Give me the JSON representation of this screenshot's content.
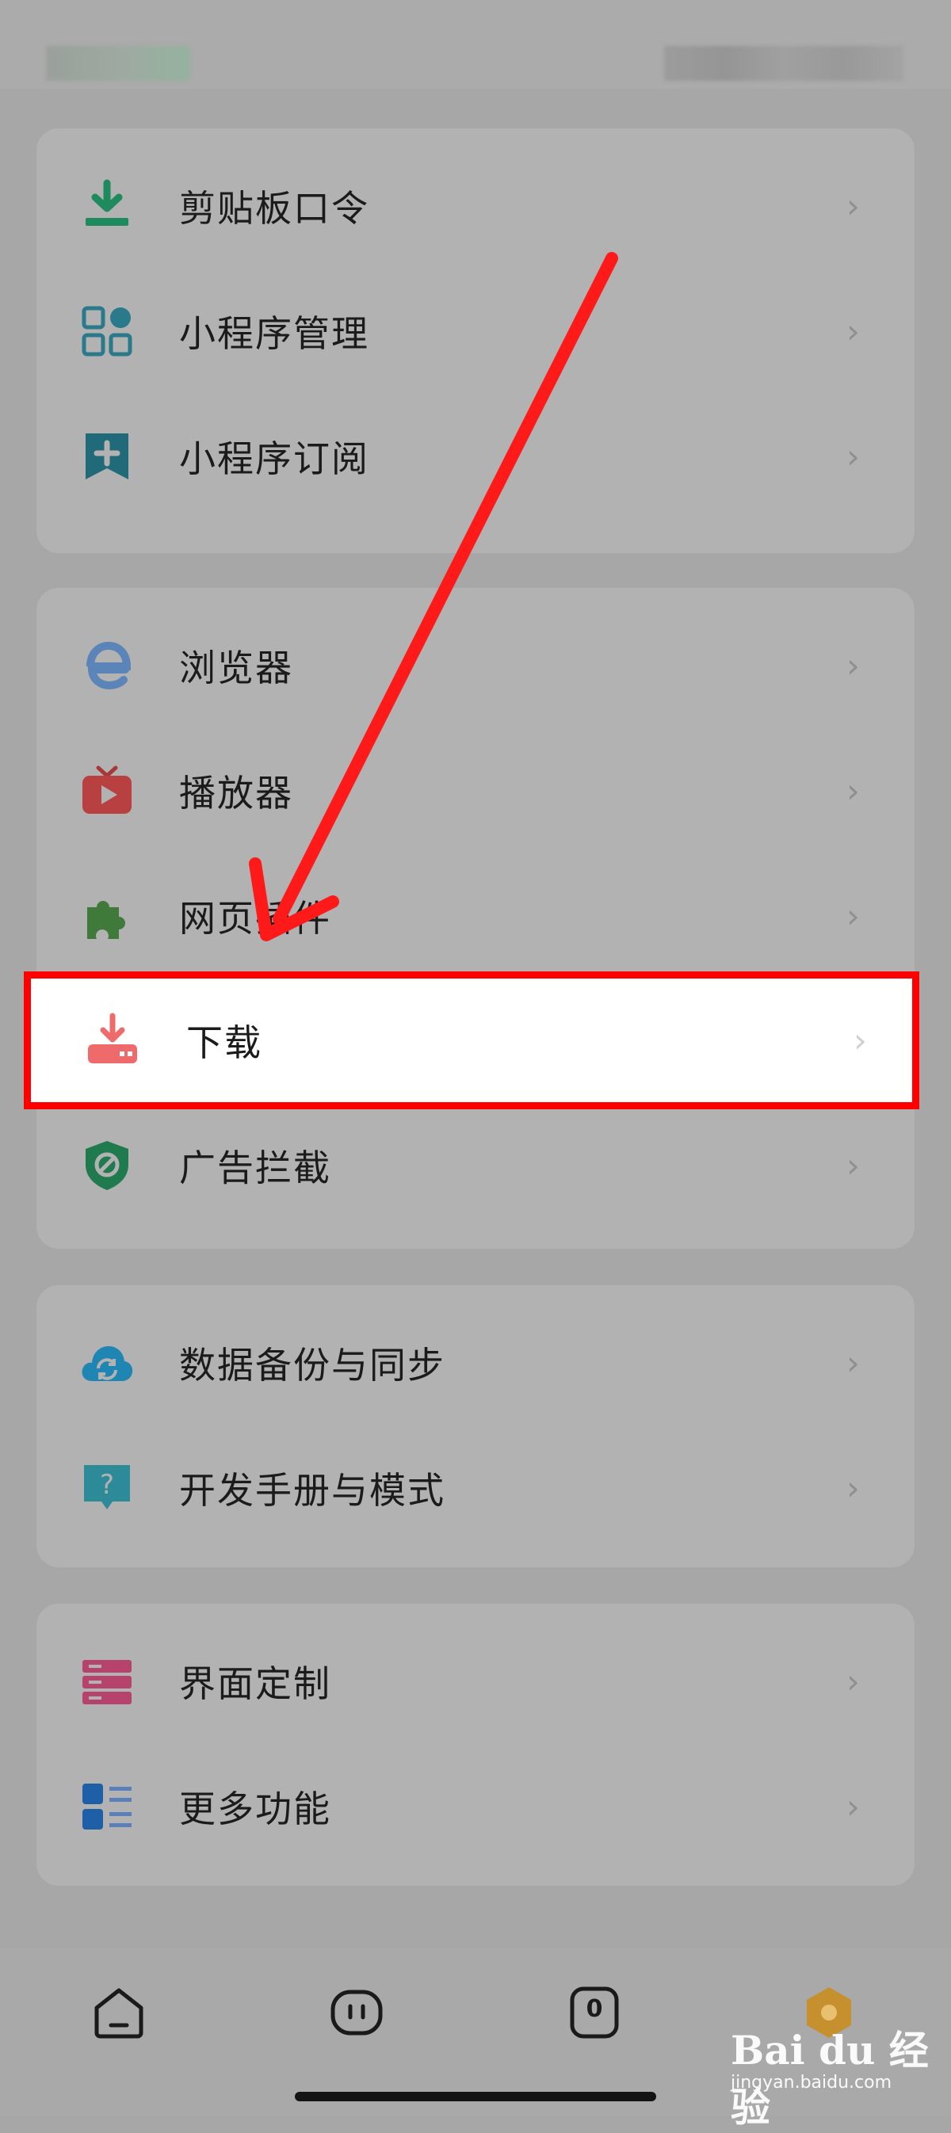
{
  "status_bar": {
    "blurred": true
  },
  "groups": [
    {
      "items": [
        {
          "label": "剪贴板口令",
          "icon": "download-tray-icon"
        },
        {
          "label": "小程序管理",
          "icon": "apps-grid-icon"
        },
        {
          "label": "小程序订阅",
          "icon": "bookmark-plus-icon"
        }
      ]
    },
    {
      "items": [
        {
          "label": "浏览器",
          "icon": "browser-e-icon"
        },
        {
          "label": "播放器",
          "icon": "tv-play-icon"
        },
        {
          "label": "网页插件",
          "icon": "puzzle-icon"
        },
        {
          "label": "下载",
          "icon": "download-icon",
          "highlighted": true
        },
        {
          "label": "广告拦截",
          "icon": "shield-block-icon"
        }
      ]
    },
    {
      "items": [
        {
          "label": "数据备份与同步",
          "icon": "cloud-sync-icon"
        },
        {
          "label": "开发手册与模式",
          "icon": "help-bubble-icon"
        }
      ]
    },
    {
      "items": [
        {
          "label": "界面定制",
          "icon": "layout-icon"
        },
        {
          "label": "更多功能",
          "icon": "list-icon"
        }
      ]
    }
  ],
  "chevron": "›",
  "bottom_nav": {
    "tab_count_badge": "0",
    "tabs": [
      "home-icon",
      "chat-icon",
      "tabs-count-icon",
      "profile-icon"
    ]
  },
  "watermark": {
    "brand": "Bai du 经验",
    "url": "jingyan.baidu.com"
  },
  "colors": {
    "highlight_border": "#ff0000",
    "arrow": "#ff0000"
  }
}
